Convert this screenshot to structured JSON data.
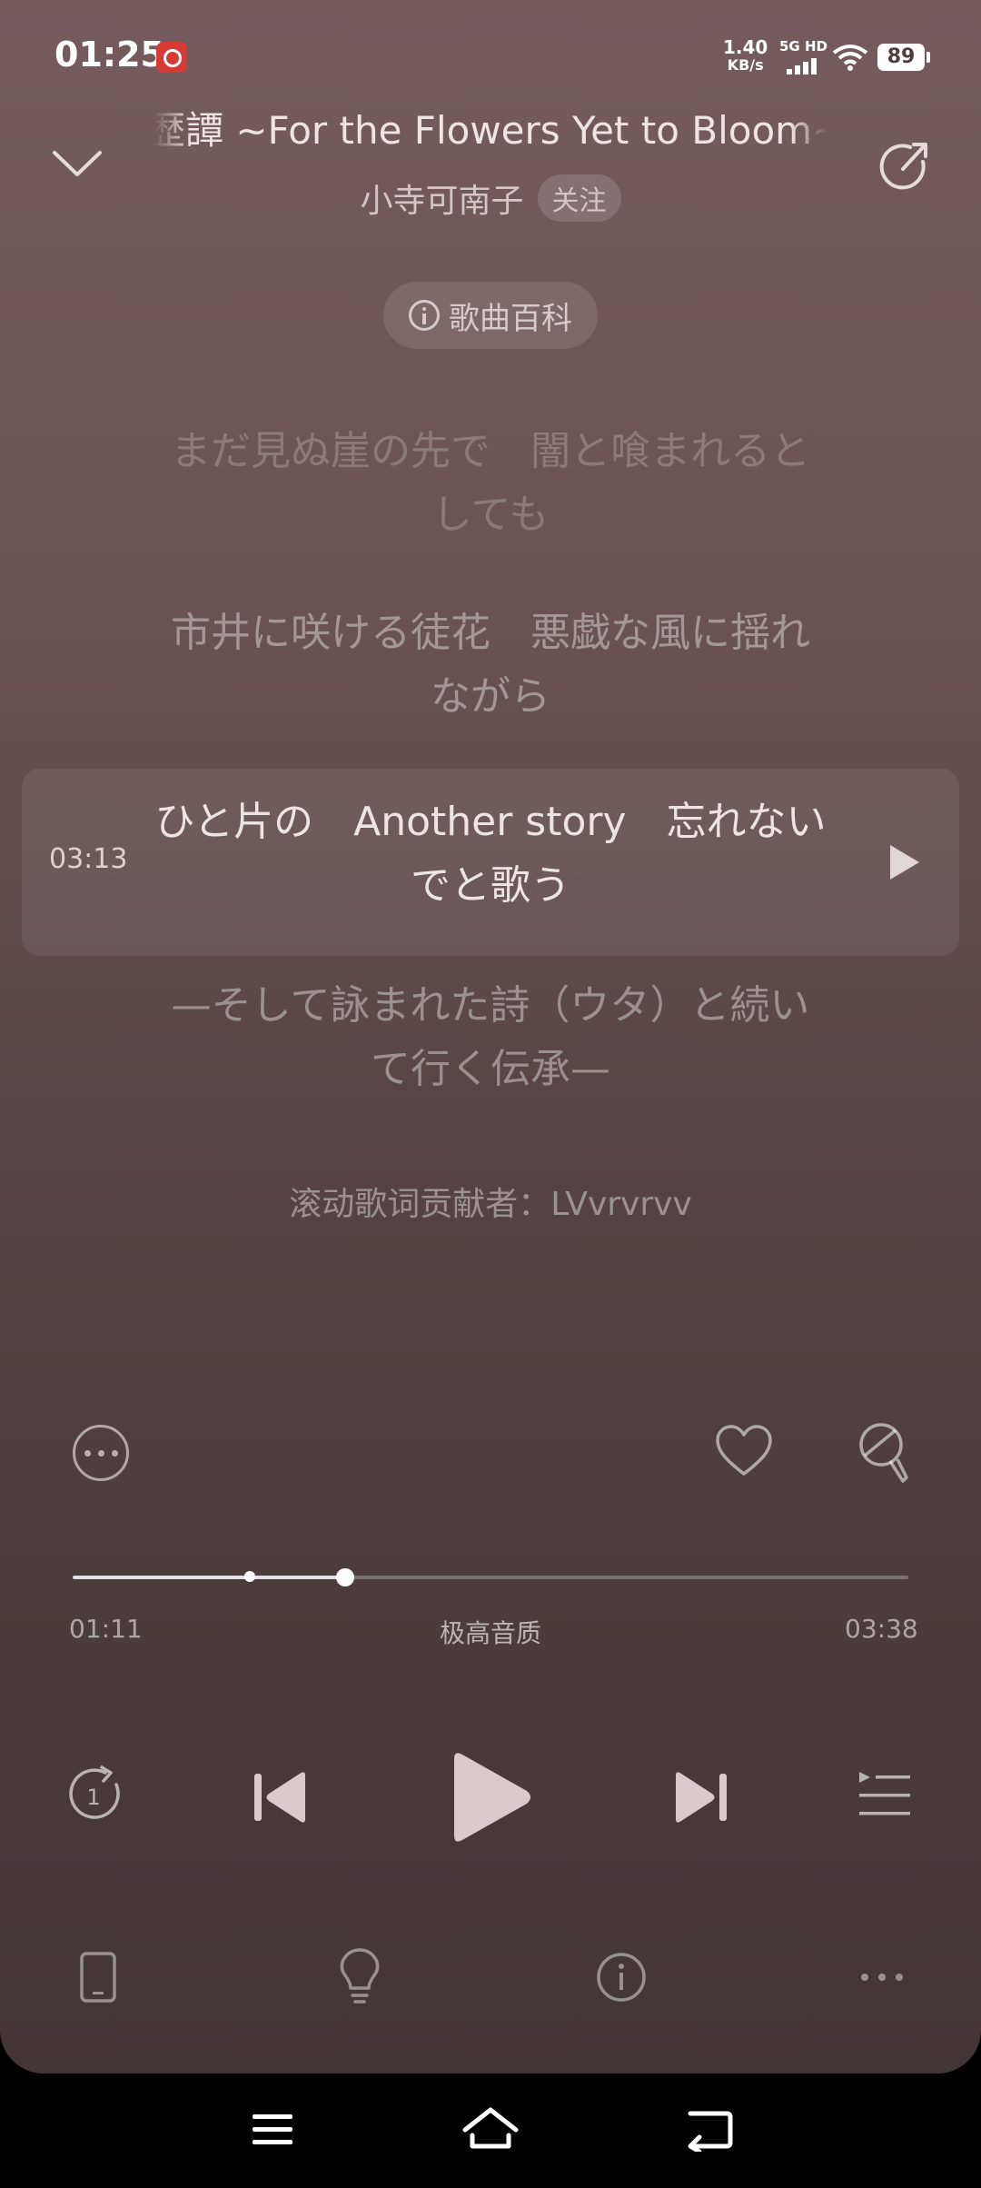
{
  "status_bar": {
    "time": "01:25",
    "net_speed_value": "1.40",
    "net_speed_unit": "KB/s",
    "net_type": "5G HD",
    "battery": "89",
    "notification_icon": "netease-music-icon"
  },
  "header": {
    "title": "歴譚 ~For the Flowers Yet to Bloom~",
    "artist": "小寺可南子",
    "follow_label": "关注",
    "wiki_label": "歌曲百科"
  },
  "lyrics": {
    "lines": [
      "まだ見ぬ崖の先で　闇と喰まれるとしても",
      "市井に咲ける徒花　悪戯な風に揺れながら",
      "ひと片の　Another story　忘れないでと歌う",
      "—そして詠まれた詩（ウタ）と続いて行く伝承—"
    ],
    "current_index": 2,
    "current_time": "03:13",
    "contributor": "滚动歌词贡献者：LVvrvrvv"
  },
  "actions": {
    "more_icon": "more-circle-icon",
    "like_icon": "heart-icon",
    "sing_icon": "microphone-icon"
  },
  "progress": {
    "current": "01:11",
    "total": "03:38",
    "quality": "极高音质",
    "played_fraction": 0.326,
    "marker_fraction": 0.212
  },
  "controls": {
    "repeat_icon": "repeat-one-icon",
    "prev_icon": "previous-track-icon",
    "play_icon": "play-icon",
    "next_icon": "next-track-icon",
    "playlist_icon": "playlist-icon"
  },
  "bottom_bar": {
    "device_icon": "phone-device-icon",
    "bulb_icon": "lightbulb-icon",
    "info_icon": "info-icon",
    "more_icon": "more-dots-icon"
  },
  "colors": {
    "background_top": "#755b5e",
    "background_bottom": "#433637",
    "text_primary": "#efe3e4"
  }
}
